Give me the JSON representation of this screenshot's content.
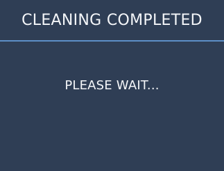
{
  "header": {
    "title": "CLEANING COMPLETED"
  },
  "body": {
    "status_message": "PLEASE WAIT..."
  },
  "colors": {
    "background": "#2f3e55",
    "divider": "#5d8fc7",
    "text": "#f4f6f9"
  }
}
